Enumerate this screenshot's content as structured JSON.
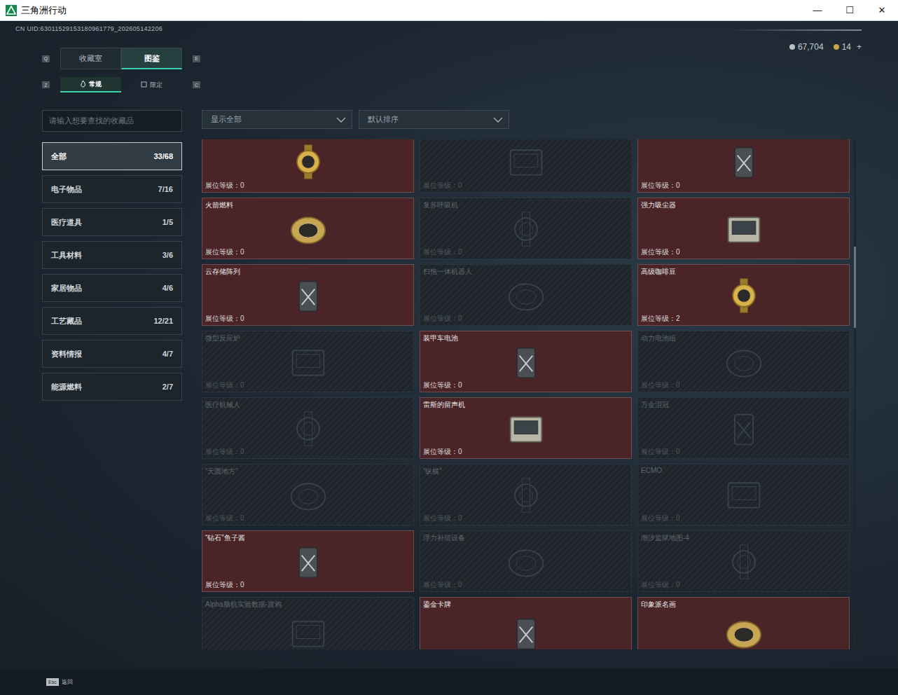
{
  "window": {
    "title": "三角洲行动",
    "controls": [
      "—",
      "☐",
      "✕"
    ]
  },
  "uid": "CN UID:63011529153180961779_202605142206",
  "currency": [
    {
      "amount": "67,704",
      "color": "#b9c0c6"
    },
    {
      "amount": "14",
      "color": "#c9a24a",
      "action": "+"
    }
  ],
  "main_tabs": {
    "prev_key": "Q",
    "next_key": "E",
    "tabs": [
      {
        "label": "收藏室",
        "selected": false
      },
      {
        "label": "图鉴",
        "selected": true
      }
    ]
  },
  "sub_tabs": {
    "prev_key": "Z",
    "next_key": "C",
    "tabs": [
      {
        "label": "常规",
        "selected": true
      },
      {
        "label": "限定",
        "selected": false
      }
    ]
  },
  "search": {
    "placeholder": "请输入想要查找的收藏品"
  },
  "filters": [
    {
      "label": "显示全部"
    },
    {
      "label": "默认排序"
    }
  ],
  "categories": [
    {
      "name": "全部",
      "count": "33/68",
      "selected": true
    },
    {
      "name": "电子物品",
      "count": "7/16",
      "selected": false
    },
    {
      "name": "医疗道具",
      "count": "1/5",
      "selected": false
    },
    {
      "name": "工具材料",
      "count": "3/6",
      "selected": false
    },
    {
      "name": "家居物品",
      "count": "4/6",
      "selected": false
    },
    {
      "name": "工艺藏品",
      "count": "12/21",
      "selected": false
    },
    {
      "name": "资料情报",
      "count": "4/7",
      "selected": false
    },
    {
      "name": "能源燃料",
      "count": "2/7",
      "selected": false
    }
  ],
  "level_label": "展位等级：",
  "items": [
    {
      "owned": true,
      "level": "0"
    },
    {
      "owned": false,
      "level": "0"
    },
    {
      "owned": true,
      "level": "0"
    },
    {
      "name": "火箭燃料",
      "owned": true,
      "level": "0"
    },
    {
      "name": "复苏呼吸机",
      "owned": false,
      "level": "0"
    },
    {
      "name": "强力吸尘器",
      "owned": true,
      "level": "0"
    },
    {
      "name": "云存储阵列",
      "owned": true,
      "level": "0"
    },
    {
      "name": "扫拖一体机器人",
      "owned": false,
      "level": "0"
    },
    {
      "name": "高级咖啡豆",
      "owned": true,
      "level": "2"
    },
    {
      "name": "微型反应炉",
      "owned": false,
      "level": "0"
    },
    {
      "name": "装甲车电池",
      "owned": true,
      "level": "0"
    },
    {
      "name": "动力电池组",
      "owned": false,
      "level": "0"
    },
    {
      "name": "医疗机械人",
      "owned": false,
      "level": "0"
    },
    {
      "name": "雷斯的留声机",
      "owned": true,
      "level": "0"
    },
    {
      "name": "万金泪冠",
      "owned": false,
      "level": "0"
    },
    {
      "name": "“天圆地方”",
      "owned": false,
      "level": "0"
    },
    {
      "name": "“纵横”",
      "owned": false,
      "level": "0"
    },
    {
      "name": "ECMO",
      "owned": false,
      "level": "0"
    },
    {
      "name": "“钻石”鱼子酱",
      "owned": true,
      "level": "0"
    },
    {
      "name": "浮力补偿设备",
      "owned": false,
      "level": "0"
    },
    {
      "name": "潮汐监狱地图-4",
      "owned": false,
      "level": "0"
    },
    {
      "name": "Alpha脑机实验数据-渡鸦",
      "owned": false
    },
    {
      "name": "鎏金卡牌",
      "owned": true
    },
    {
      "name": "印象派名画",
      "owned": true
    }
  ],
  "scrollbar": {
    "position": 0.21,
    "size": 0.16
  },
  "footer": {
    "key": "Esc",
    "label": "返回"
  }
}
